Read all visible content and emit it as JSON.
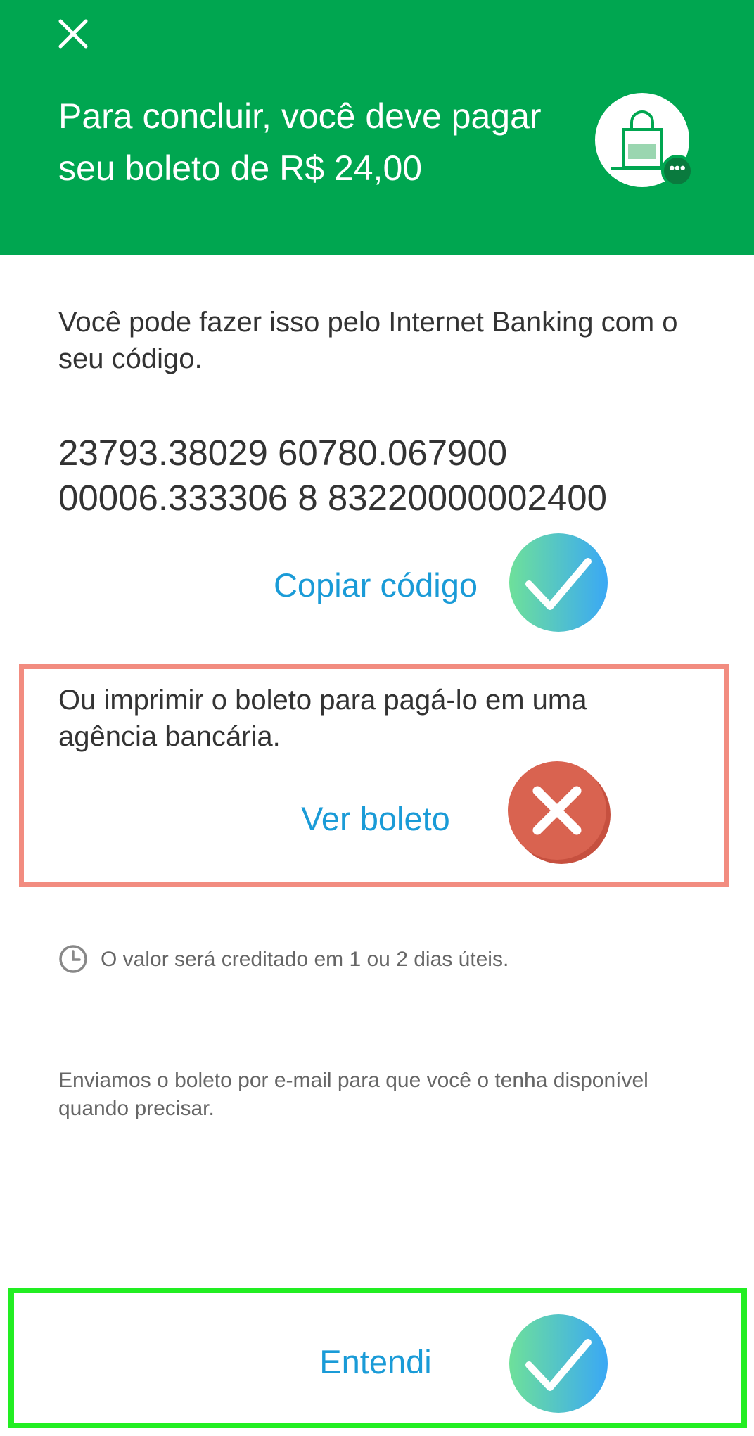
{
  "header": {
    "close_icon": "close-icon",
    "title": "Para concluir, você deve pagar seu boleto de R$ 24,00",
    "illustration_icon": "shopping-bag-icon",
    "badge_icon": "more-dots-icon",
    "background_color": "#00a650"
  },
  "main": {
    "intro": "Você pode fazer isso pelo Internet Banking com o seu código.",
    "code_line_1": "23793.38029 60780.067900",
    "code_line_2": "00006.333306 8 83220000002400",
    "copy_label": "Copiar código",
    "print_intro": "Ou imprimir o boleto para pagá-lo em uma agência bancária.",
    "view_label": "Ver boleto",
    "credit_info": "O valor será creditado em 1 ou 2 dias úteis.",
    "email_info": "Enviamos o boleto por e-mail para que você o tenha disponível quando precisar.",
    "link_color": "#1a9bd7"
  },
  "footer": {
    "ok_label": "Entendi"
  },
  "overlays": {
    "copy_mark": "check-icon",
    "view_mark": "x-icon",
    "ok_mark": "check-icon",
    "highlight_red": "#f28c80",
    "highlight_green": "#22ee22"
  }
}
